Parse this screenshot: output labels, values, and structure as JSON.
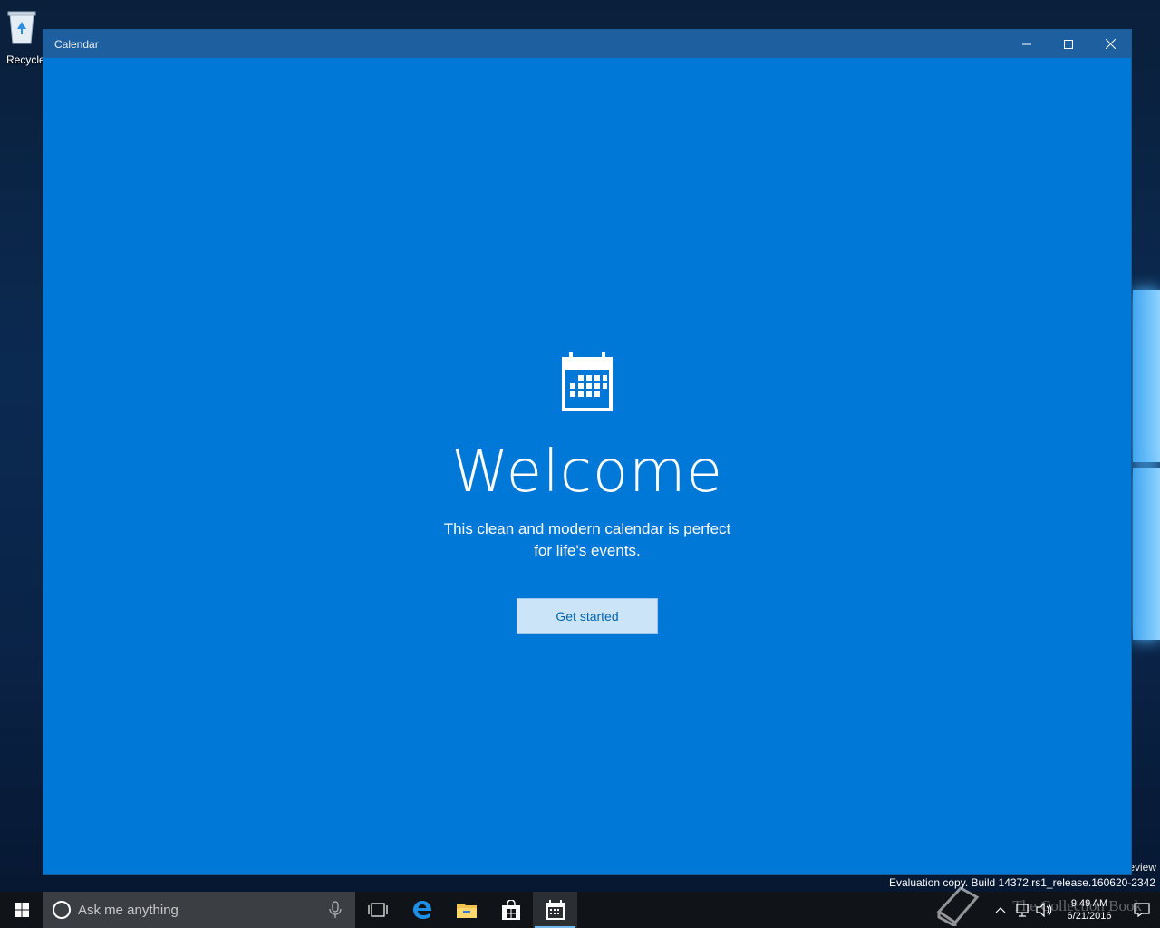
{
  "desktop": {
    "recycle_bin_label": "Recycle",
    "watermark_edition": "eview",
    "watermark_build": "Evaluation copy. Build 14372.rs1_release.160620-2342",
    "overlay_brand": "The Collection Book"
  },
  "window": {
    "title": "Calendar",
    "minimize_icon": "minimize-icon",
    "maximize_icon": "maximize-icon",
    "close_icon": "close-icon"
  },
  "welcome_page": {
    "icon": "calendar-icon",
    "heading": "Welcome",
    "subtitle_line1": "This clean and modern calendar is perfect",
    "subtitle_line2": "for life's events.",
    "button_label": "Get started"
  },
  "taskbar": {
    "search_placeholder": "Ask me anything",
    "pinned": [
      "task-view",
      "edge",
      "file-explorer",
      "store",
      "calendar"
    ],
    "active_app": "calendar",
    "clock_time": "9:49 AM",
    "clock_date": "6/21/2016"
  },
  "colors": {
    "app_background": "#0078d7",
    "titlebar": "#1e5fa0",
    "button_background": "#cce4f7",
    "button_text": "#0063b1",
    "taskbar": "#101418"
  }
}
